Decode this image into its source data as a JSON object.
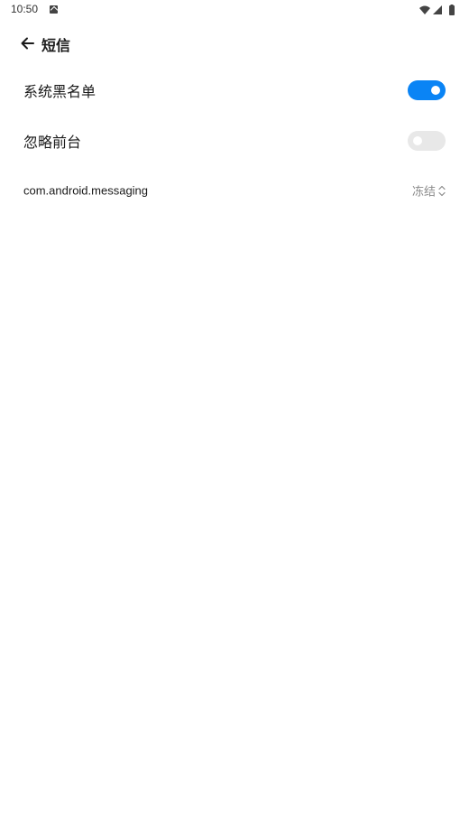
{
  "status_bar": {
    "time": "10:50",
    "icons": [
      "notification-a-icon",
      "wifi-icon",
      "signal-icon",
      "battery-icon"
    ]
  },
  "header": {
    "back_icon": "arrow-left-icon",
    "title": "短信"
  },
  "settings": {
    "system_blacklist": {
      "label": "系统黑名单",
      "enabled": true
    },
    "ignore_foreground": {
      "label": "忽略前台",
      "enabled": false
    },
    "package": {
      "label": "com.android.messaging",
      "value": "冻结",
      "icon": "up-down-chevron-icon"
    }
  },
  "colors": {
    "accent": "#0a84f5",
    "toggle_off": "#e8e8e8",
    "secondary_text": "#8a8a8a"
  }
}
